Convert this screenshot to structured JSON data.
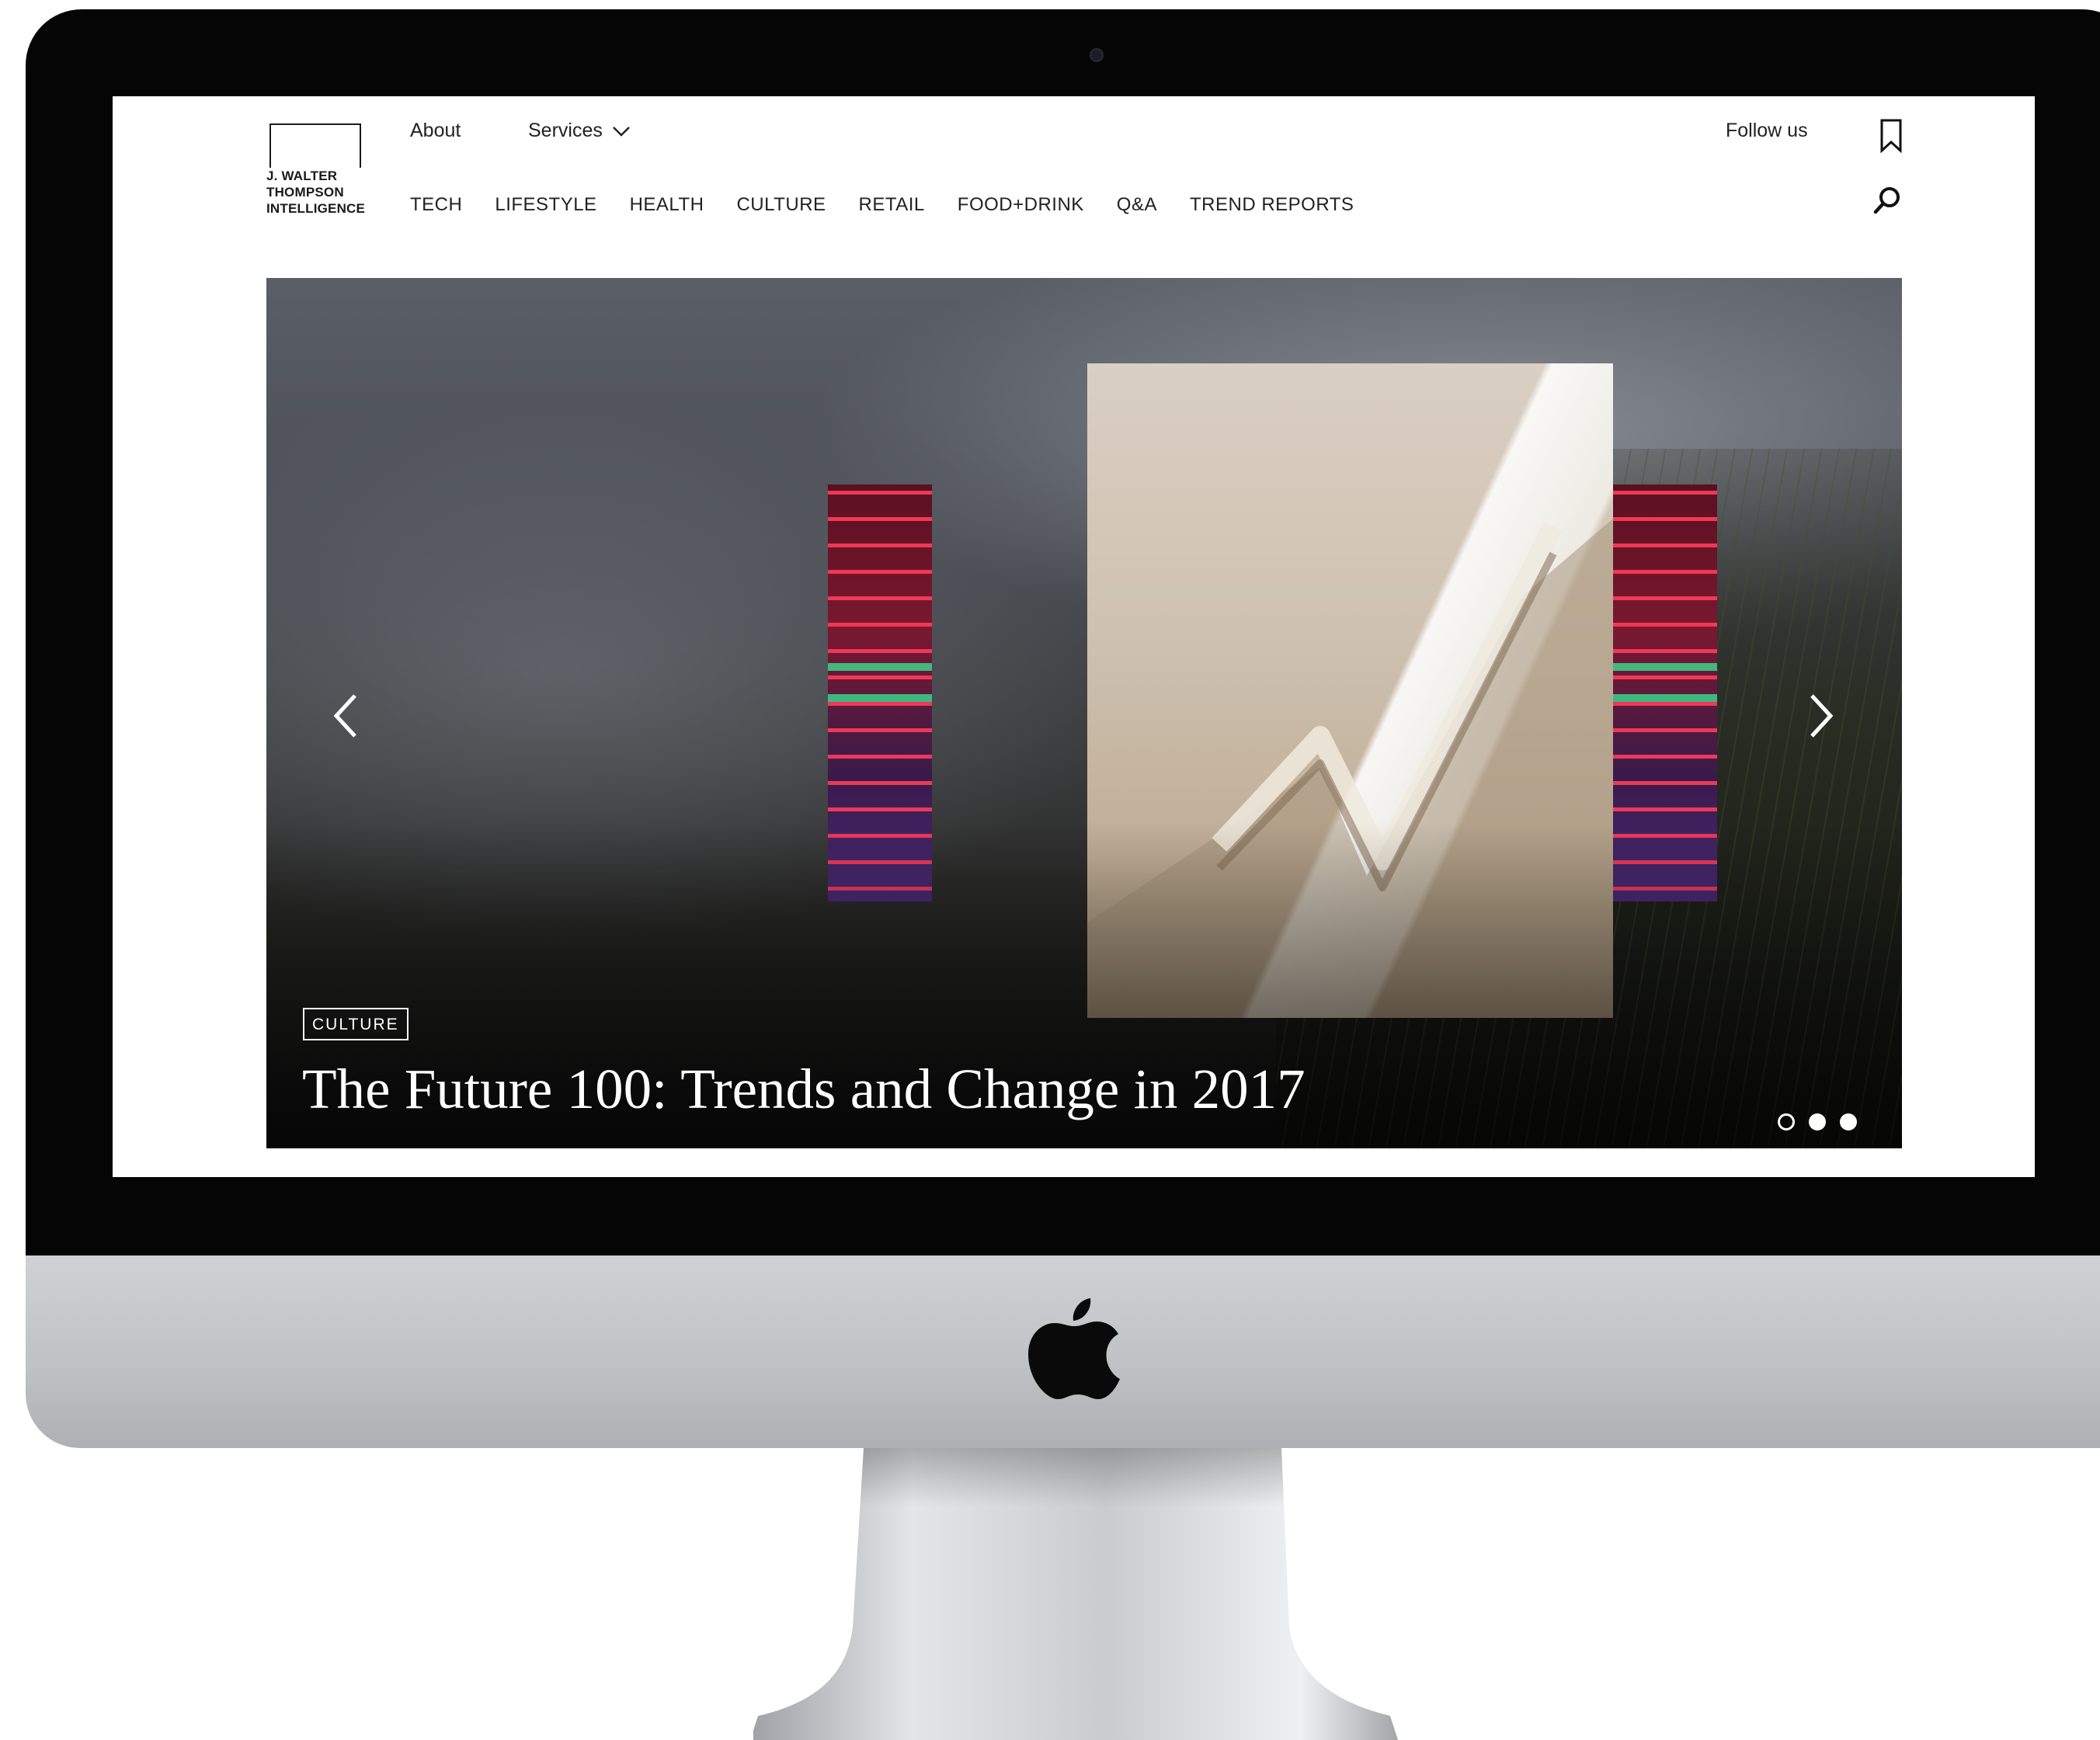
{
  "logo": {
    "text": "J. WALTER\nTHOMPSON\nINTELLIGENCE"
  },
  "topnav": {
    "about": "About",
    "services": "Services",
    "follow": "Follow us"
  },
  "categories": [
    "TECH",
    "LIFESTYLE",
    "HEALTH",
    "CULTURE",
    "RETAIL",
    "FOOD+DRINK",
    "Q&A",
    "TREND REPORTS"
  ],
  "hero": {
    "tag": "CULTURE",
    "headline": "The Future 100: Trends and Change in 2017",
    "slide_count": 3,
    "active_slide": 1
  },
  "icons": [
    "chevron-down-icon",
    "bookmark-icon",
    "search-icon",
    "arrow-left-icon",
    "arrow-right-icon",
    "apple-logo-icon"
  ],
  "colors": {
    "bezel": "#050505",
    "chin": "#c0c2c6",
    "nav_text": "#222222",
    "hero_text": "#ffffff"
  }
}
